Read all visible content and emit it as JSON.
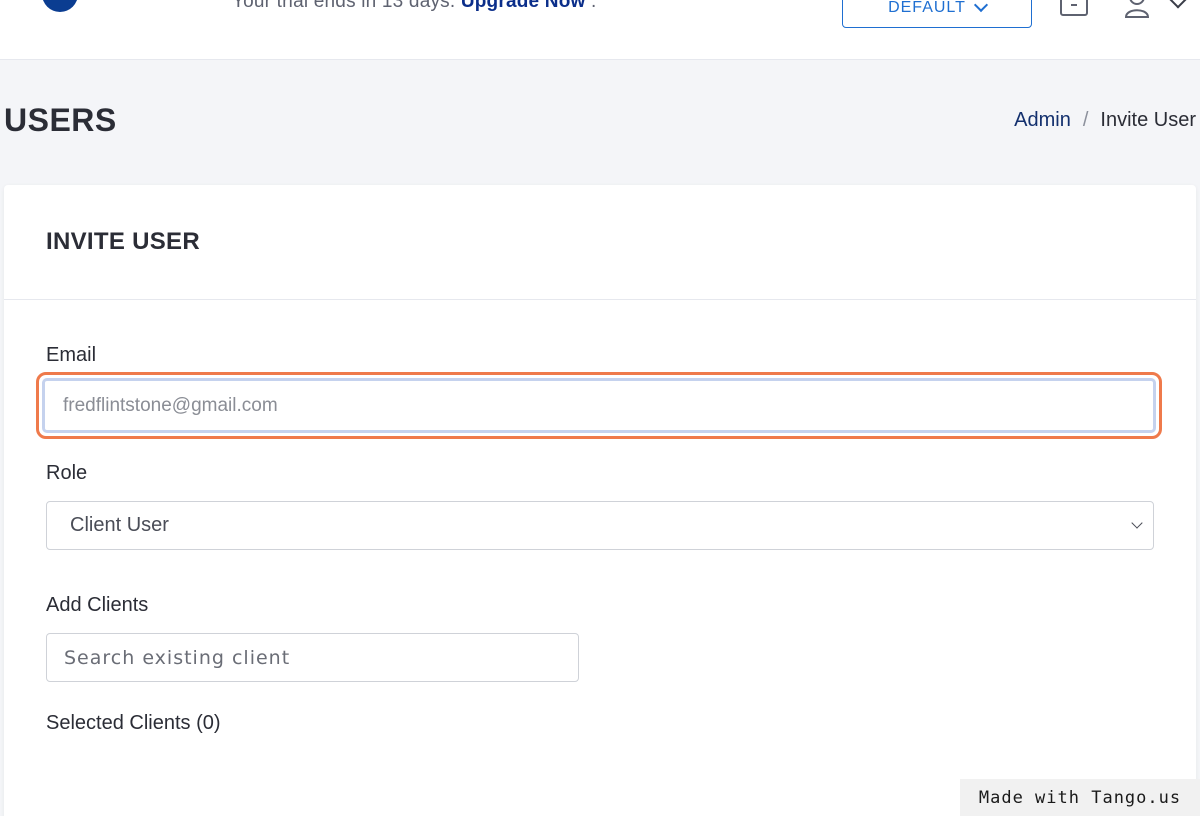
{
  "topbar": {
    "trial_text": "Your trial ends in 13 days.",
    "upgrade_link": "Upgrade Now",
    "trial_suffix": ".",
    "environment_button": "DEFAULT"
  },
  "page": {
    "title": "USERS",
    "breadcrumb": {
      "parent": "Admin",
      "separator": "/",
      "current": "Invite User"
    }
  },
  "form": {
    "title": "INVITE USER",
    "email": {
      "label": "Email",
      "value": "",
      "placeholder": "fredflintstone@gmail.com"
    },
    "role": {
      "label": "Role",
      "selected": "Client User"
    },
    "clients": {
      "label": "Add Clients",
      "placeholder": "Search existing client"
    },
    "selected_clients": "Selected Clients (0)"
  },
  "colors": {
    "accent": "#1f6fd1",
    "link": "#0b2e8a",
    "highlight": "#ef7a4b"
  },
  "watermark": "Made with Tango.us"
}
